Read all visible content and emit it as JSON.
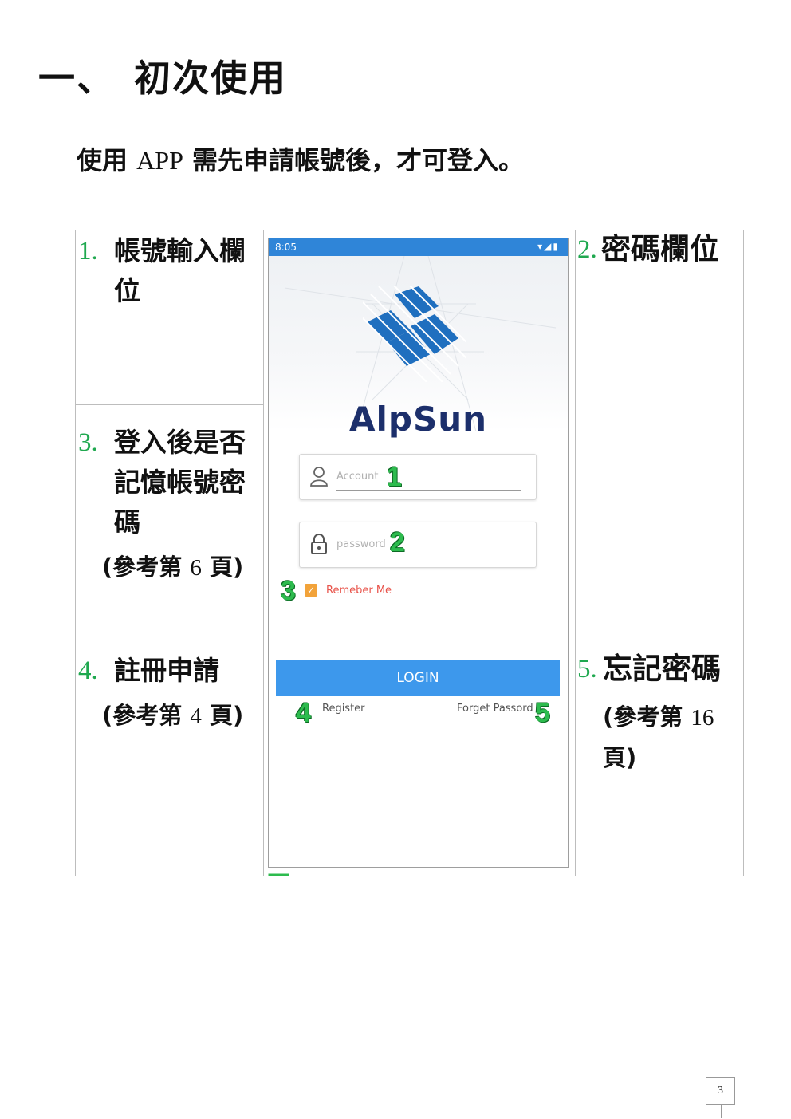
{
  "heading": {
    "number": "一、",
    "title": "初次使用"
  },
  "intro": {
    "part1": "使用",
    "app": "APP",
    "part2": "需先申請帳號後，才可登入。"
  },
  "notes": {
    "n1": {
      "num": "1.",
      "line1": "帳號輸入欄",
      "line2": "位"
    },
    "n2": {
      "num": "2.",
      "line1": "密碼欄位"
    },
    "n3": {
      "num": "3.",
      "line1": "登入後是否",
      "line2": "記憶帳號密",
      "line3": "碼",
      "ref_pre": "(參考第",
      "ref_num": "6",
      "ref_post": "頁)"
    },
    "n4": {
      "num": "4.",
      "line1": "註冊申請",
      "ref_pre": "(參考第",
      "ref_num": "4",
      "ref_post": "頁)"
    },
    "n5": {
      "num": "5.",
      "line1": "忘記密碼",
      "ref_pre": "(參考第",
      "ref_num": "16",
      "ref_post": "頁)"
    }
  },
  "phone": {
    "time": "8:05",
    "status_icons": "▾◢▮",
    "brand": "AlpSun",
    "account_placeholder": "Account",
    "password_placeholder": "password",
    "remember_label": "Remeber Me",
    "login_label": "LOGIN",
    "register_label": "Register",
    "forget_label": "Forget Passord",
    "badges": [
      "1",
      "2",
      "3",
      "4",
      "5"
    ]
  },
  "page_number": "3",
  "colors": {
    "number_green": "#1fa84f",
    "badge_green": "#2dbb4e",
    "statusbar": "#2f85d8",
    "login_button": "#3d98ec",
    "remember_text": "#e8534a",
    "checkbox": "#f2a33a",
    "brand_navy": "#1c2f6b"
  }
}
